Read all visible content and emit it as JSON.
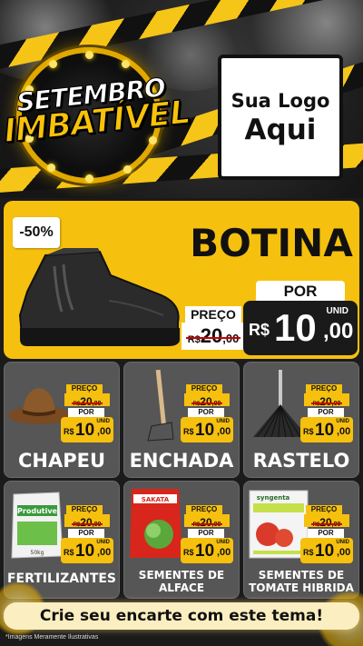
{
  "header": {
    "badge_line1": "SETEMBRO",
    "badge_line2": "IMBATÍVEL",
    "logo_line1": "Sua Logo",
    "logo_line2": "Aqui"
  },
  "hero": {
    "discount": "-50%",
    "title": "BOTINA",
    "price_label": "PREÇO",
    "old_price": {
      "currency": "R$",
      "integer": "20",
      "decimal": ",00"
    },
    "por_label": "POR",
    "new_price": {
      "unit": "UNID",
      "currency": "R$",
      "integer": "10",
      "decimal": ",00"
    }
  },
  "products": [
    {
      "name": "CHAPEU",
      "price_label": "PREÇO",
      "old_price": {
        "currency": "R$",
        "integer": "20",
        "decimal": ",00"
      },
      "por_label": "POR",
      "new_price": {
        "unit": "UNID",
        "currency": "R$",
        "integer": "10",
        "decimal": ",00"
      }
    },
    {
      "name": "ENCHADA",
      "price_label": "PREÇO",
      "old_price": {
        "currency": "R$",
        "integer": "20",
        "decimal": ",00"
      },
      "por_label": "POR",
      "new_price": {
        "unit": "UNID",
        "currency": "R$",
        "integer": "10",
        "decimal": ",00"
      }
    },
    {
      "name": "RASTELO",
      "price_label": "PREÇO",
      "old_price": {
        "currency": "R$",
        "integer": "20",
        "decimal": ",00"
      },
      "por_label": "POR",
      "new_price": {
        "unit": "UNID",
        "currency": "R$",
        "integer": "10",
        "decimal": ",00"
      }
    },
    {
      "name": "FERTILIZANTES",
      "package_brand": "Produtive",
      "package_weight": "50kg",
      "price_label": "PREÇO",
      "old_price": {
        "currency": "R$",
        "integer": "20",
        "decimal": ",00"
      },
      "por_label": "POR",
      "new_price": {
        "unit": "UNID",
        "currency": "R$",
        "integer": "10",
        "decimal": ",00"
      }
    },
    {
      "name_line1": "SEMENTES DE",
      "name_line2": "ALFACE",
      "package_brand": "SAKATA",
      "price_label": "PREÇO",
      "old_price": {
        "currency": "R$",
        "integer": "20",
        "decimal": ",00"
      },
      "por_label": "POR",
      "new_price": {
        "unit": "UNID",
        "currency": "R$",
        "integer": "10",
        "decimal": ",00"
      }
    },
    {
      "name_line1": "SEMENTES DE",
      "name_line2": "TOMATE HIBRIDA",
      "package_brand": "syngenta",
      "price_label": "PREÇO",
      "old_price": {
        "currency": "R$",
        "integer": "20",
        "decimal": ",00"
      },
      "por_label": "POR",
      "new_price": {
        "unit": "UNID",
        "currency": "R$",
        "integer": "10",
        "decimal": ",00"
      }
    }
  ],
  "footer": {
    "cta": "Crie seu encarte com este tema!",
    "disclaimer": "*Imagens Meramente Ilustrativas"
  },
  "colors": {
    "accent_yellow": "#f6c00e",
    "card_gray": "#565656",
    "background": "#1b1b1b"
  }
}
